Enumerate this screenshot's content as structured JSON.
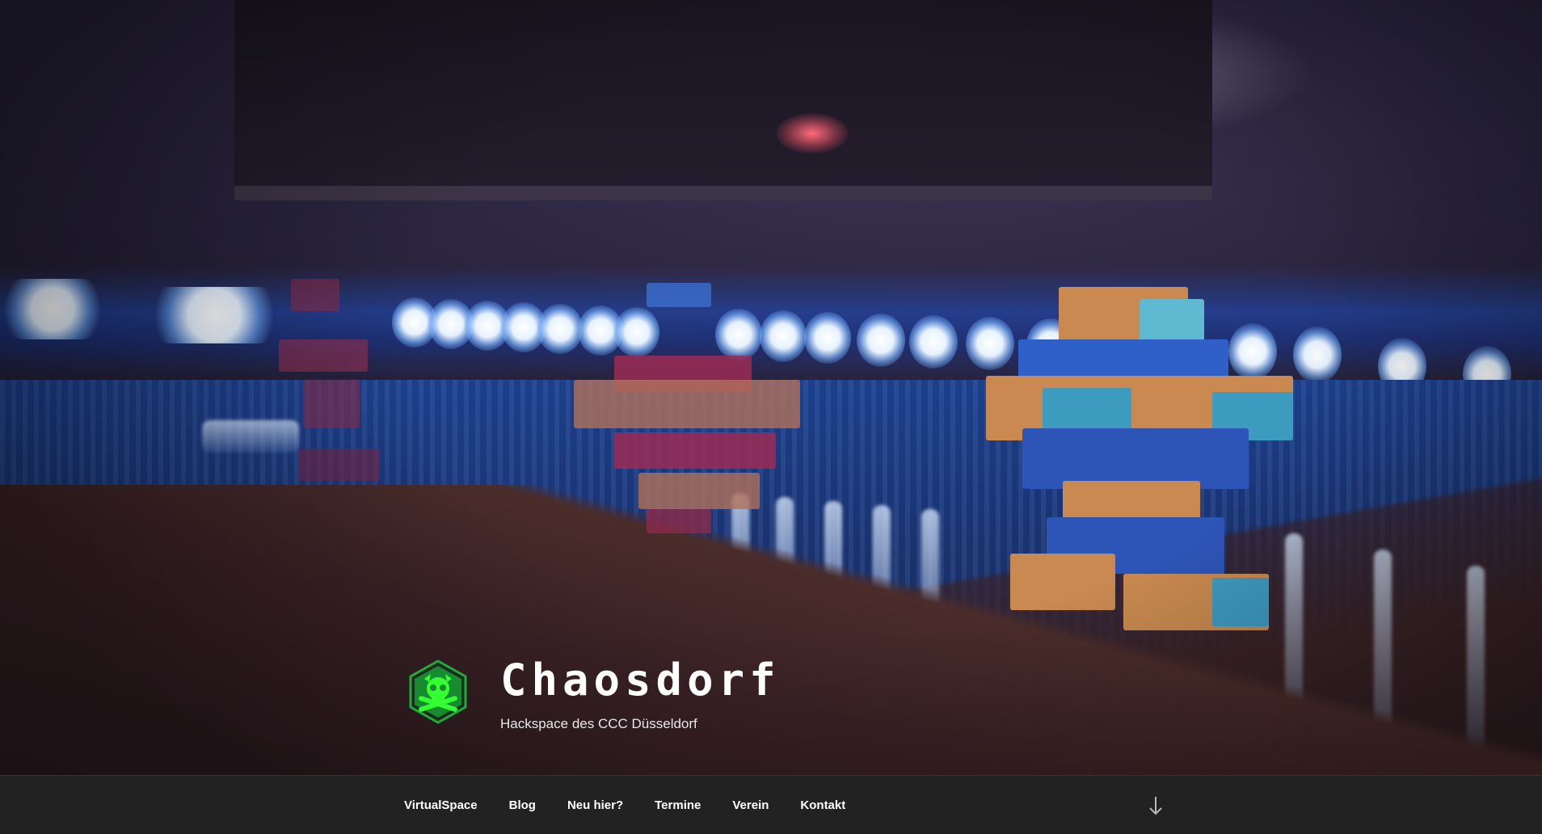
{
  "site": {
    "title": "Chaosdorf",
    "description": "Hackspace des CCC Düsseldorf"
  },
  "header_image": {
    "icon": "lego-led-shelf-photo"
  },
  "logo": {
    "icon": "chaosdorf-skull-hexagon-icon",
    "colors": {
      "hex": "#1faa3a",
      "skull": "#33ff33"
    }
  },
  "nav": {
    "items": [
      {
        "label": "VirtualSpace"
      },
      {
        "label": "Blog"
      },
      {
        "label": "Neu hier?"
      },
      {
        "label": "Termine"
      },
      {
        "label": "Verein"
      },
      {
        "label": "Kontakt"
      }
    ],
    "scroll_icon": "arrow-down-icon"
  },
  "colors": {
    "navbar_bg": "#222222",
    "nav_text": "#ffffff"
  }
}
